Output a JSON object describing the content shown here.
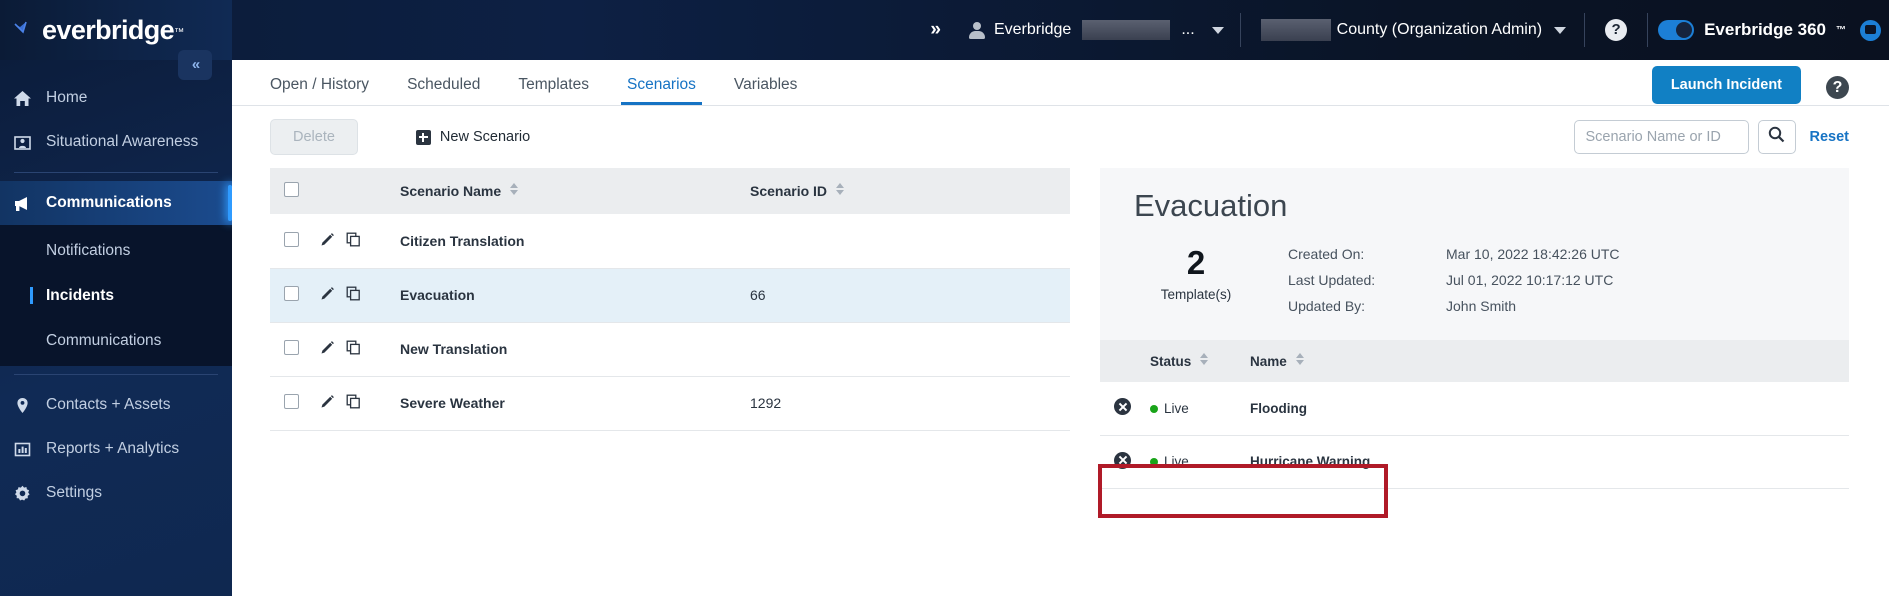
{
  "brand": {
    "logo_text": "everbridge",
    "logo_tm": "™",
    "check_icon": "check-mark-icon"
  },
  "topbar": {
    "expand_chevrons": "»",
    "user_icon": "person-icon",
    "user_label": "Everbridge",
    "user_truncate": "...",
    "org_label": "County (Organization Admin)",
    "help_label": "?",
    "e360_label": "Everbridge 360",
    "e360_tm": "™",
    "toggle_on": true,
    "chat_icon": "chat-bubble-icon",
    "accent_blue": "#1c7fd6"
  },
  "sidebar": {
    "collapse_label": "«",
    "items": [
      {
        "label": "Home",
        "icon": "home-icon",
        "active": false
      },
      {
        "label": "Situational Awareness",
        "icon": "map-pin-person-icon",
        "active": false
      },
      {
        "label": "Communications",
        "icon": "megaphone-icon",
        "active": true
      }
    ],
    "sub_items": [
      {
        "label": "Notifications",
        "active": false
      },
      {
        "label": "Incidents",
        "active": true
      },
      {
        "label": "Communications",
        "active": false
      }
    ],
    "items_lower": [
      {
        "label": "Contacts + Assets",
        "icon": "location-pin-icon"
      },
      {
        "label": "Reports + Analytics",
        "icon": "bar-chart-icon"
      },
      {
        "label": "Settings",
        "icon": "gear-icon"
      }
    ]
  },
  "tabs": [
    {
      "label": "Open / History",
      "active": false
    },
    {
      "label": "Scheduled",
      "active": false
    },
    {
      "label": "Templates",
      "active": false
    },
    {
      "label": "Scenarios",
      "active": true
    },
    {
      "label": "Variables",
      "active": false
    }
  ],
  "header_actions": {
    "launch_incident": "Launch Incident",
    "help": "?",
    "launch_color": "#1180c4"
  },
  "toolbar": {
    "delete_label": "Delete",
    "delete_disabled": true,
    "new_scenario_label": "New Scenario",
    "new_scenario_icon": "plus-square-icon",
    "search_placeholder": "Scenario Name or ID",
    "search_value": "",
    "search_icon": "search-icon",
    "reset_label": "Reset"
  },
  "scenario_table": {
    "columns": [
      "",
      "",
      "Scenario Name",
      "Scenario ID"
    ],
    "header_name": "Scenario Name",
    "header_id": "Scenario ID",
    "rows": [
      {
        "name": "Citizen Translation",
        "id": "",
        "selected": false
      },
      {
        "name": "Evacuation",
        "id": "66",
        "selected": true
      },
      {
        "name": "New Translation",
        "id": "",
        "selected": false
      },
      {
        "name": "Severe Weather",
        "id": "1292",
        "selected": false
      }
    ]
  },
  "detail": {
    "title": "Evacuation",
    "template_count": "2",
    "template_label": "Template(s)",
    "meta": [
      {
        "key": "Created On:",
        "value": "Mar 10, 2022 18:42:26 UTC"
      },
      {
        "key": "Last Updated:",
        "value": "Jul 01, 2022 10:17:12 UTC"
      },
      {
        "key": "Updated By:",
        "value": "John Smith"
      }
    ],
    "sub_header_status": "Status",
    "sub_header_name": "Name",
    "sub_rows": [
      {
        "status": "Live",
        "name": "Flooding",
        "highlighted": true
      },
      {
        "status": "Live",
        "name": "Hurricane Warning",
        "highlighted": false
      }
    ],
    "status_dot_color": "#19a419",
    "highlight_color": "#b01a28"
  }
}
